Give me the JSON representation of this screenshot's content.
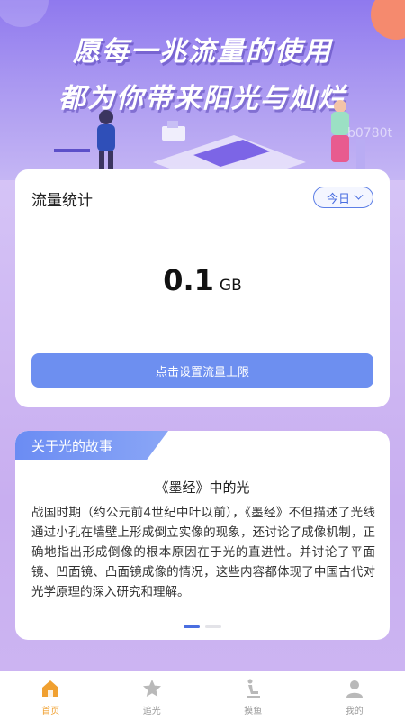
{
  "hero": {
    "slogan_line1": "愿每一兆流量的使用",
    "slogan_line2": "都为你带来阳光与灿烂",
    "watermark": "b0780t"
  },
  "stats": {
    "title": "流量统计",
    "period": "今日",
    "usage_value": "0.1",
    "usage_unit": "GB",
    "limit_button": "点击设置流量上限"
  },
  "story": {
    "tab_label": "关于光的故事",
    "title": "《墨经》中的光",
    "body": "战国时期（约公元前4世纪中叶以前），《墨经》不但描述了光线通过小孔在墙壁上形成倒立实像的现象，还讨论了成像机制，正确地指出形成倒像的根本原因在于光的直进性。并讨论了平面镜、凹面镜、凸面镜成像的情况，这些内容都体现了中国古代对光学原理的深入研究和理解。",
    "page_count": 2,
    "active_page": 1
  },
  "tabbar": {
    "items": [
      {
        "label": "首页",
        "icon": "home-icon",
        "active": true
      },
      {
        "label": "追光",
        "icon": "star-icon",
        "active": false
      },
      {
        "label": "摸鱼",
        "icon": "seat-icon",
        "active": false
      },
      {
        "label": "我的",
        "icon": "user-icon",
        "active": false
      }
    ]
  },
  "colors": {
    "accent": "#4a6ee0",
    "button": "#6d8ff0",
    "tab_active": "#f0a030",
    "tab_inactive": "#b9b9b9"
  }
}
